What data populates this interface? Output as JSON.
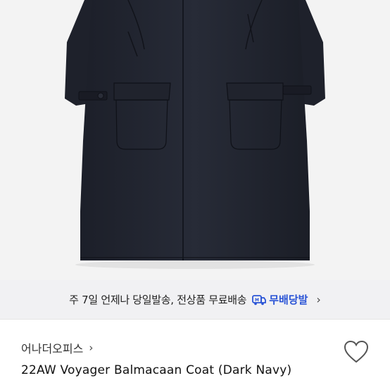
{
  "banner": {
    "text": "주 7일 언제나 당일발송, 전상품 무료배송",
    "badge_label": "무배당발",
    "badge_icon": "delivery-truck-icon",
    "chevron": "›",
    "badge_color": "#2a54d6"
  },
  "product": {
    "brand": "어나더오피스",
    "brand_chevron": "›",
    "title": "22AW Voyager Balmacaan Coat (Dark Navy)",
    "wishlist_icon": "heart-outline-icon",
    "image_description_icon": "product-photo"
  }
}
